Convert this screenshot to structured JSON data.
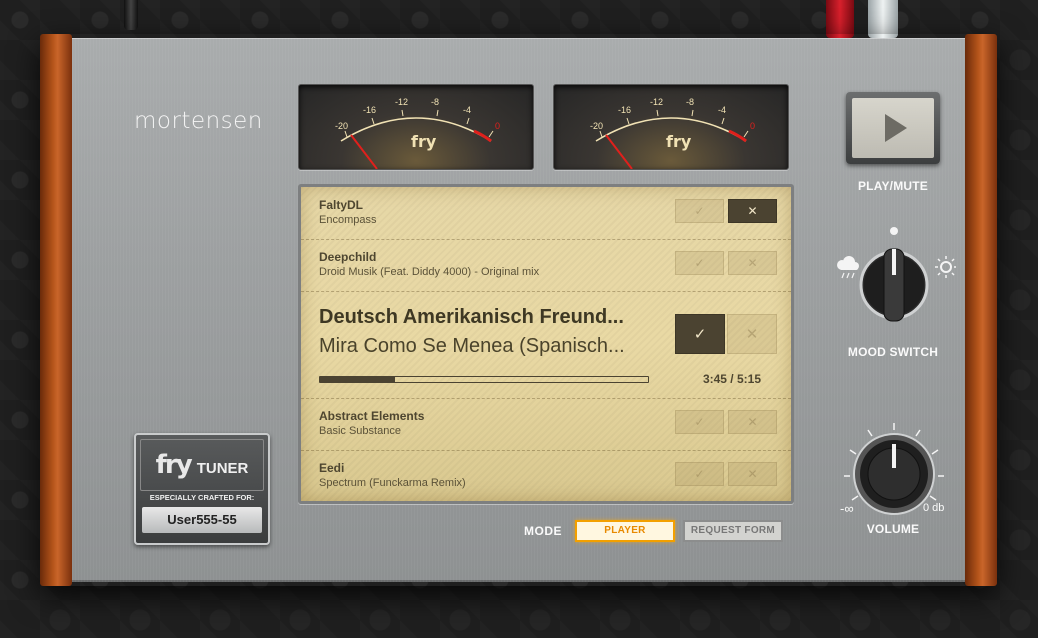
{
  "brand": {
    "name": "mortensen"
  },
  "meters": [
    {
      "scale": [
        "-20",
        "-16",
        "-12",
        "-8",
        "-4",
        "0"
      ],
      "logo": "fry"
    },
    {
      "scale": [
        "-20",
        "-16",
        "-12",
        "-8",
        "-4",
        "0"
      ],
      "logo": "fry"
    }
  ],
  "tracks": [
    {
      "artist": "FaltyDL",
      "title": "Encompass",
      "approve": "✓",
      "reject": "✕",
      "rejected": true
    },
    {
      "artist": "Deepchild",
      "title": "Droid Musik (Feat. Diddy 4000) - Original mix",
      "approve": "✓",
      "reject": "✕"
    },
    {
      "artist": "Deutsch Amerikanisch Freund...",
      "title": "Mira Como Se Menea (Spanisch...",
      "approve": "✓",
      "reject": "✕",
      "current": true,
      "progress": 0.23,
      "time": "3:45 / 5:15"
    },
    {
      "artist": "Abstract Elements",
      "title": "Basic Substance",
      "approve": "✓",
      "reject": "✕"
    },
    {
      "artist": "Eedi",
      "title": "Spectrum (Funckarma Remix)",
      "approve": "✓",
      "reject": "✕"
    }
  ],
  "badge": {
    "logo": "fry",
    "name": "TUNER",
    "subtitle": "ESPECIALLY CRAFTED FOR:",
    "user": "User555-55"
  },
  "mode": {
    "label": "MODE",
    "player": "PLAYER",
    "request": "REQUEST FORM",
    "selected": "PLAYER"
  },
  "controls": {
    "play_label": "PLAY/MUTE",
    "mood_label": "MOOD SWITCH",
    "volume_label": "VOLUME",
    "volume_min": "-∞",
    "volume_max": "0 db"
  },
  "colors": {
    "accent": "#f3a000",
    "display_bg": "#e6d7a6",
    "dark_button": "#4b4331",
    "wood": "#b4541a",
    "needle": "#e0201c"
  },
  "icons": [
    "play-icon",
    "check-icon",
    "close-icon",
    "cloud-rain-icon",
    "sun-icon",
    "mood-knob-icon",
    "volume-knob-icon",
    "fry-logo-icon"
  ]
}
